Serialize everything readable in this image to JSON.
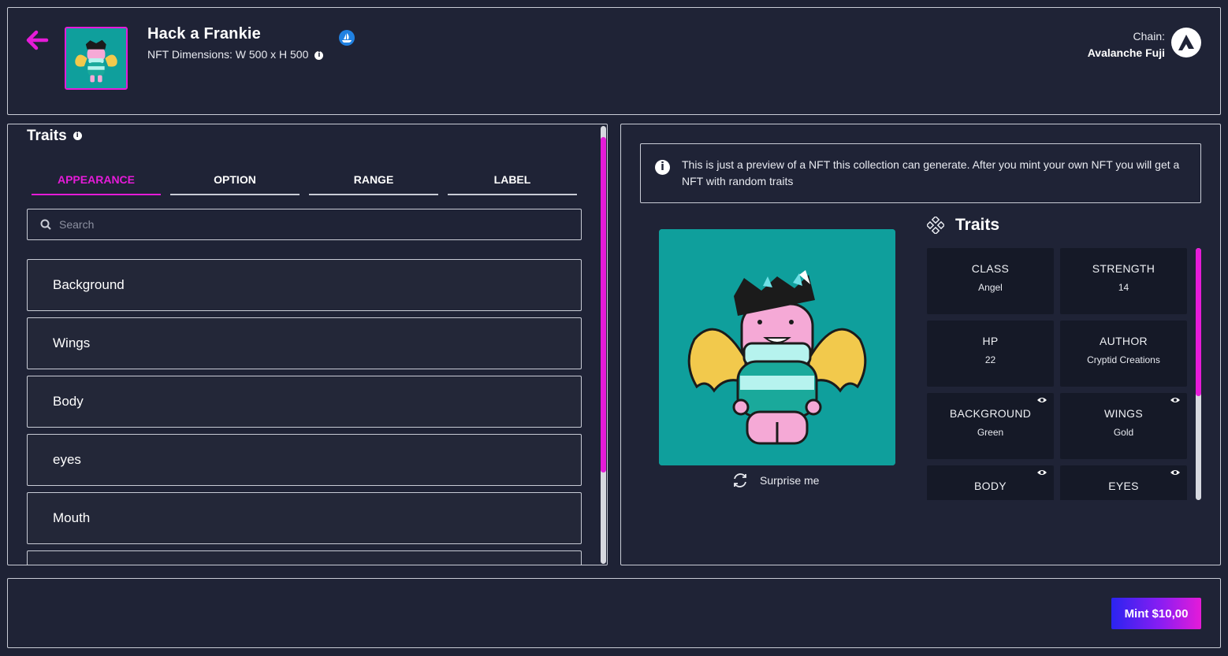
{
  "header": {
    "title": "Hack a Frankie",
    "dimensions": "NFT Dimensions: W 500 x H 500",
    "chain_label": "Chain:",
    "chain_name": "Avalanche Fuji"
  },
  "left": {
    "heading": "Traits",
    "tabs": [
      "APPEARANCE",
      "OPTION",
      "RANGE",
      "LABEL"
    ],
    "search_placeholder": "Search",
    "items": [
      "Background",
      "Wings",
      "Body",
      "eyes",
      "Mouth"
    ]
  },
  "right": {
    "notice": "This is just a preview of a NFT this collection can generate. After you mint your own NFT you will get a NFT with random traits",
    "surprise": "Surprise me",
    "heading": "Traits",
    "traits": [
      {
        "key": "CLASS",
        "value": "Angel"
      },
      {
        "key": "STRENGTH",
        "value": "14"
      },
      {
        "key": "HP",
        "value": "22"
      },
      {
        "key": "AUTHOR",
        "value": "Cryptid Creations"
      },
      {
        "key": "BACKGROUND",
        "value": "Green"
      },
      {
        "key": "WINGS",
        "value": "Gold"
      },
      {
        "key": "BODY",
        "value": ""
      },
      {
        "key": "EYES",
        "value": ""
      }
    ]
  },
  "footer": {
    "mint_label": "Mint $10,00"
  },
  "colors": {
    "accent": "#e51bd8",
    "background": "#1e2235",
    "nft_bg": "#0f9f9c"
  }
}
